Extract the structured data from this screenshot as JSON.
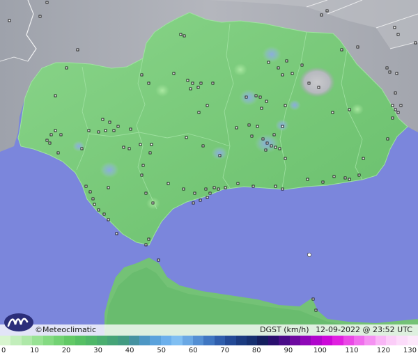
{
  "footer": {
    "copyright": "©Meteoclimatic",
    "variable": "DGST (km/h)",
    "datetime": "12-09-2022 @ 23:52 UTC"
  },
  "logo": {
    "icon": "meteoclimatic-logo-icon"
  },
  "colors": {
    "sea": "#7b86dc",
    "land_outside": "#a6a9b2",
    "land_mountain": "#c4c6cc",
    "region_fill": "#79c97b",
    "station_marker": "#111111"
  },
  "scale": {
    "ticks": [
      "0",
      "10",
      "20",
      "30",
      "40",
      "50",
      "60",
      "70",
      "80",
      "90",
      "100",
      "110",
      "120",
      "130"
    ],
    "colors": [
      "#d8f5cf",
      "#c2eebb",
      "#aee8a8",
      "#98e294",
      "#84da82",
      "#72d273",
      "#62c966",
      "#56c064",
      "#4fb768",
      "#4aae6f",
      "#45a477",
      "#429b82",
      "#4592a0",
      "#4e97c4",
      "#5aa2dc",
      "#6cb0ec",
      "#80bff2",
      "#6aa8e4",
      "#548fd3",
      "#3f76c1",
      "#2f5eac",
      "#234a96",
      "#1b3b80",
      "#163070",
      "#141f5e",
      "#2a0f6e",
      "#4a0c88",
      "#6d0aa0",
      "#8f08b8",
      "#b006cc",
      "#cc08d8",
      "#e020e0",
      "#ea48e6",
      "#f06ded",
      "#f592f2",
      "#f9b6f6",
      "#fbcdf8",
      "#fcdcfa",
      "#fde8fb"
    ]
  }
}
